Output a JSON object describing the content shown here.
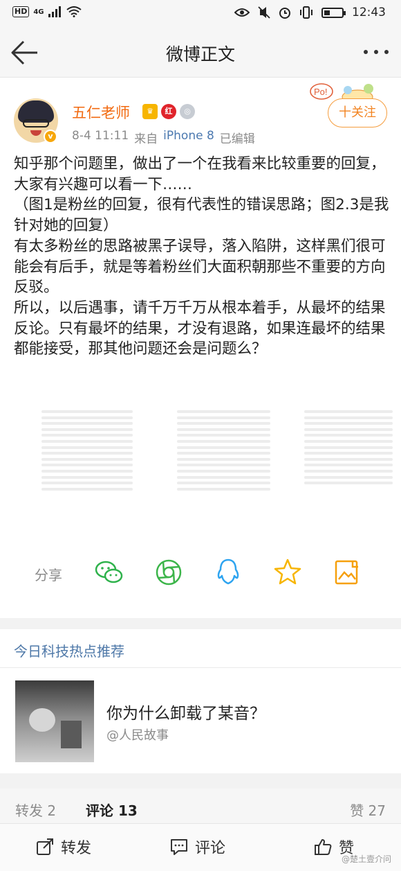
{
  "status_bar": {
    "hd": "HD",
    "network": "4G",
    "time": "12:43"
  },
  "nav": {
    "title": "微博正文"
  },
  "author": {
    "name": "五仁老师",
    "verified_badge": "v",
    "badges": [
      "crown-icon",
      "red-badge-icon",
      "silver-medal-icon"
    ],
    "date": "8-4 11:11",
    "source_prefix": "来自",
    "device": "iPhone 8",
    "edited": "已编辑"
  },
  "follow": {
    "label": "十关注",
    "deco": "Po!"
  },
  "post": {
    "paragraphs": [
      "知乎那个问题里，做出了一个在我看来比较重要的回复，大家有兴趣可以看一下……",
      "（图1是粉丝的回复，很有代表性的错误思路；图2.3是我针对她的回复）",
      "有太多粉丝的思路被黑子误导，落入陷阱，这样黑们很可能会有后手，就是等着粉丝们大面积朝那些不重要的方向反驳。",
      "所以，以后遇事，请千万千万从根本着手，从最坏的结果反论。只有最坏的结果，才没有退路，如果连最坏的结果都能接受，那其他问题还会是问题么？"
    ]
  },
  "share": {
    "label": "分享",
    "icons": [
      "wechat-icon",
      "moments-icon",
      "qq-icon",
      "qzone-icon",
      "save-image-icon"
    ],
    "colors": {
      "wechat": "#2fb24c",
      "moments": "#3cb54a",
      "qq": "#2ea4f0",
      "qzone": "#f7b500",
      "save": "#f6a00c"
    }
  },
  "recommend": {
    "title": "今日科技热点推荐",
    "headline": "你为什么卸载了某音？",
    "source": "@人民故事"
  },
  "stats": {
    "repost": "转发 2",
    "comment": "评论 13",
    "like": "赞 27"
  },
  "actions": {
    "repost": "转发",
    "comment": "评论",
    "like": "赞"
  },
  "watermark": "@楚土壹介问",
  "colors": {
    "accent_orange": "#f26a10",
    "link_blue": "#4c79b0"
  }
}
